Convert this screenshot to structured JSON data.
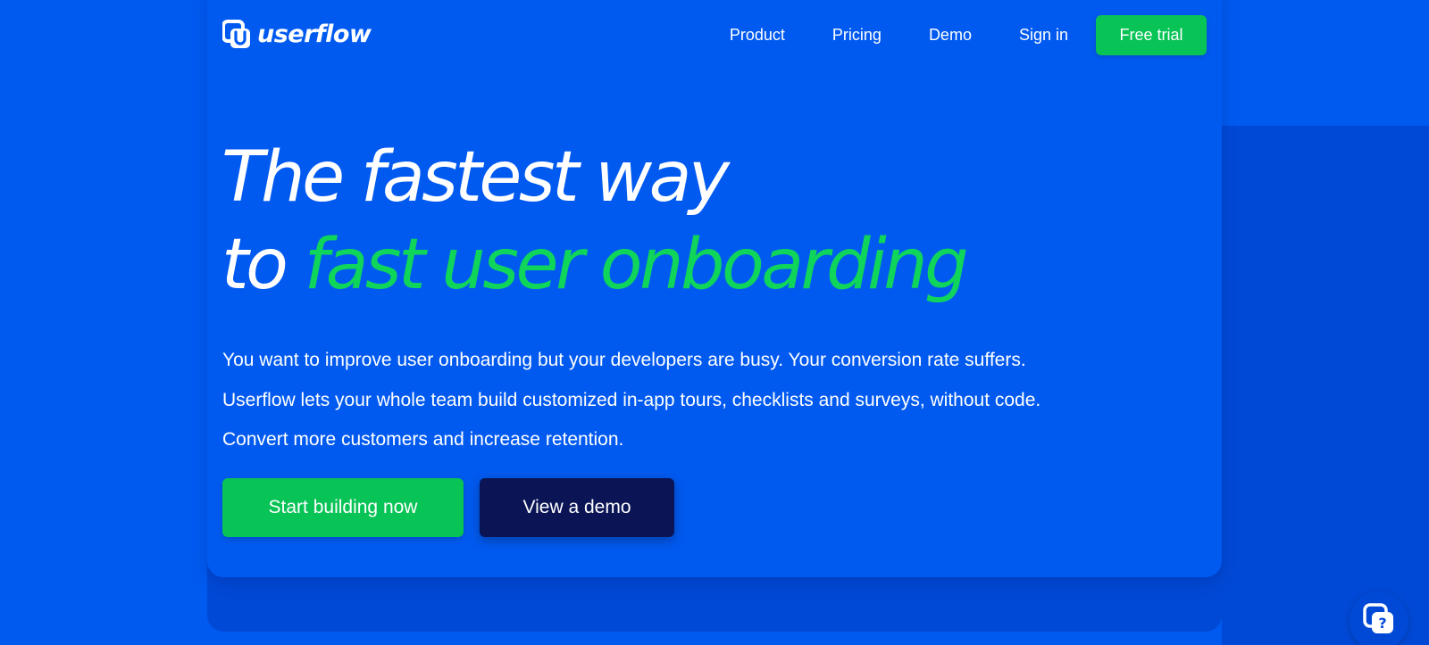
{
  "header": {
    "logo_text": "userflow",
    "logo_icon": "userflow-logo-icon",
    "nav": [
      {
        "label": "Product"
      },
      {
        "label": "Pricing"
      },
      {
        "label": "Demo"
      },
      {
        "label": "Sign in"
      }
    ],
    "cta_label": "Free trial"
  },
  "hero": {
    "headline_line1": "The fastest way",
    "headline_line2_prefix": "to ",
    "headline_line2_highlight": "fast user onboarding",
    "paragraphs": [
      "You want to improve user onboarding but your developers are busy. Your conversion rate suffers.",
      "Userflow lets your whole team build customized in-app tours, checklists and surveys, without code.",
      "Convert more customers and increase retention."
    ],
    "primary_cta": "Start building now",
    "secondary_cta": "View a demo"
  },
  "help_widget": {
    "icon": "help-chat-icon"
  },
  "colors": {
    "background": "#005af0",
    "accent_green": "#0fd55a",
    "button_green": "#08c355",
    "dark_navy": "#0b1555",
    "panel_shade": "#0049d6"
  }
}
